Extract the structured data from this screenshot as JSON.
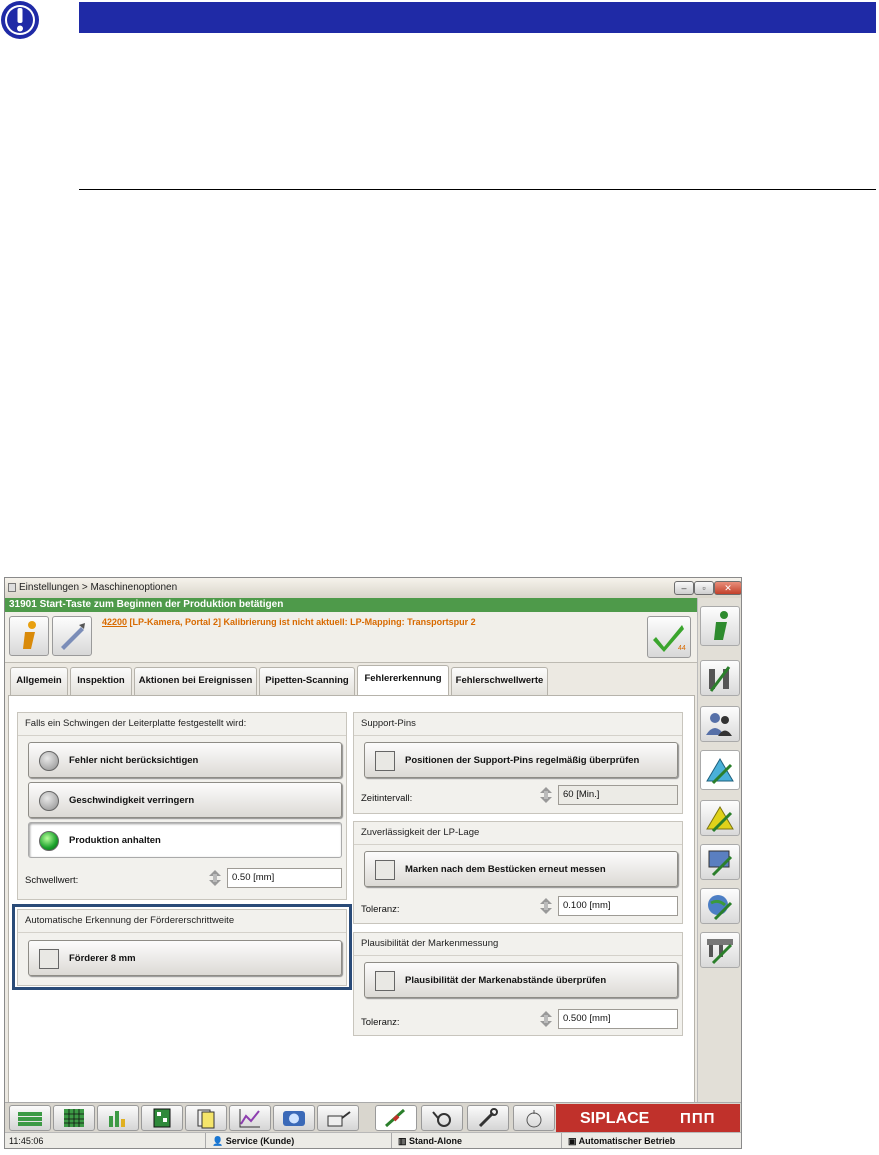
{
  "icons": {
    "notice": "exclamation-icon",
    "info": "info-icon",
    "pen": "pen-icon",
    "check": "check-icon"
  },
  "colors": {
    "notice_bar": "#1f2aa6",
    "status_green": "#4e9a4a",
    "message_orange": "#d86a00",
    "highlight_border": "#2a4b78",
    "brand_red": "#c0312b"
  },
  "window": {
    "breadcrumb": "Einstellungen > Maschinenoptionen",
    "status_line": "31901 Start-Taste zum Beginnen der Produktion betätigen",
    "message_code": "42200",
    "message_text": " [LP-Kamera, Portal 2] Kalibrierung ist nicht aktuell: LP-Mapping: Transportspur 2",
    "check_count": "44"
  },
  "tabs": [
    {
      "label": "Allgemein",
      "active": false
    },
    {
      "label": "Inspektion",
      "active": false
    },
    {
      "label": "Aktionen bei Ereignissen",
      "active": false
    },
    {
      "label": "Pipetten-Scanning",
      "active": false
    },
    {
      "label": "Fehlererkennung",
      "active": true
    },
    {
      "label": "Fehlerschwellwerte",
      "active": false
    }
  ],
  "vibration": {
    "header": "Falls ein Schwingen der Leiterplatte festgestellt wird:",
    "options": [
      {
        "label": "Fehler nicht berücksichtigen",
        "selected": false
      },
      {
        "label": "Geschwindigkeit verringern",
        "selected": false
      },
      {
        "label": "Produktion anhalten",
        "selected": true
      }
    ],
    "threshold_label": "Schwellwert:",
    "threshold_value": "0.50 [mm]"
  },
  "feeder": {
    "header": "Automatische Erkennung der Fördererschrittweite",
    "option": "Förderer 8 mm"
  },
  "support_pins": {
    "header": "Support-Pins",
    "option": "Positionen der Support-Pins regelmäßig überprüfen",
    "interval_label": "Zeitintervall:",
    "interval_value": "60 [Min.]"
  },
  "lp_position": {
    "header": "Zuverlässigkeit der LP-Lage",
    "option": "Marken nach dem Bestücken erneut messen",
    "tolerance_label": "Toleranz:",
    "tolerance_value": "0.100 [mm]"
  },
  "mark_plausibility": {
    "header": "Plausibilität der Markenmessung",
    "option": "Plausibilität der Markenabstände überprüfen",
    "tolerance_label": "Toleranz:",
    "tolerance_value": "0.500 [mm]"
  },
  "brand": {
    "name": "SIPLACE",
    "model": "ΠΠΠ"
  },
  "bottom_bar": {
    "time": "11:45:06",
    "mode": "Service (Kunde)",
    "line": "Stand-Alone",
    "operation": "Automatischer Betrieb"
  },
  "sidebar_icons": [
    "info-icon",
    "machine-tools-icon",
    "users-icon",
    "machine-settings-icon",
    "software-icon",
    "monitor-settings-icon",
    "globe-settings-icon",
    "feeder-settings-icon"
  ],
  "taskbar_icons": [
    "money-stack-icon",
    "grid-green-icon",
    "bar-grid-icon",
    "board-icon",
    "cards-icon",
    "trend-chart-icon",
    "camera-icon",
    "oil-can-icon",
    "pipette-tool-icon",
    "hand-gear-icon",
    "wrench-icon",
    "scale-icon"
  ]
}
